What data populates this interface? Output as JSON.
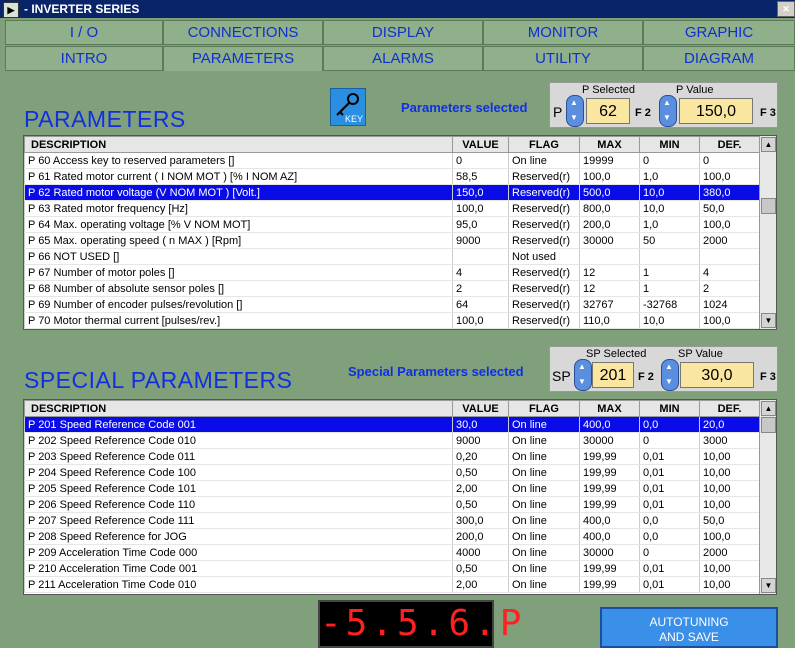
{
  "window": {
    "title": "- INVERTER SERIES"
  },
  "tabs_row1": [
    "I / O",
    "CONNECTIONS",
    "DISPLAY",
    "MONITOR",
    "GRAPHIC"
  ],
  "tabs_row2": [
    "INTRO",
    "PARAMETERS",
    "ALARMS",
    "UTILITY",
    "DIAGRAM"
  ],
  "parameters": {
    "title": "PARAMETERS",
    "selected_label": "Parameters selected",
    "key_label": "KEY",
    "selector": {
      "p_selected_label": "P Selected",
      "p_value_label": "P Value",
      "prefix": "P",
      "p_selected": "62",
      "p_value": "150,0",
      "f2": "F 2",
      "f3": "F 3"
    },
    "columns": [
      "DESCRIPTION",
      "VALUE",
      "FLAG",
      "MAX",
      "MIN",
      "DEF."
    ],
    "rows": [
      [
        "P 60   Access key to reserved parameters []",
        "0",
        "On line",
        "19999",
        "0",
        "0"
      ],
      [
        "P 61   Rated motor current ( I NOM MOT ) [% I NOM AZ]",
        "58,5",
        "Reserved(r)",
        "100,0",
        "1,0",
        "100,0"
      ],
      [
        "P 62   Rated motor voltage (V NOM MOT ) [Volt.]",
        "150,0",
        "Reserved(r)",
        "500,0",
        "10,0",
        "380,0"
      ],
      [
        "P 63   Rated motor frequency [Hz]",
        "100,0",
        "Reserved(r)",
        "800,0",
        "10,0",
        "50,0"
      ],
      [
        "P 64   Max. operating voltage [% V NOM MOT]",
        "95,0",
        "Reserved(r)",
        "200,0",
        "1,0",
        "100,0"
      ],
      [
        "P 65   Max. operating speed ( n MAX ) [Rpm]",
        "9000",
        "Reserved(r)",
        "30000",
        "50",
        "2000"
      ],
      [
        "P 66   NOT USED []",
        "",
        "Not used",
        "",
        "",
        ""
      ],
      [
        "P 67   Number of motor poles  []",
        "4",
        "Reserved(r)",
        "12",
        "1",
        "4"
      ],
      [
        "P 68   Number of absolute sensor poles []",
        "2",
        "Reserved(r)",
        "12",
        "1",
        "2"
      ],
      [
        "P 69   Number of encoder pulses/revolution []",
        "64",
        "Reserved(r)",
        "32767",
        "-32768",
        "1024"
      ],
      [
        "P 70   Motor thermal current [pulses/rev.]",
        "100,0",
        "Reserved(r)",
        "110,0",
        "10,0",
        "100,0"
      ]
    ],
    "selected_row": 2
  },
  "special": {
    "title": "SPECIAL PARAMETERS",
    "selected_label": "Special Parameters selected",
    "selector": {
      "sp_selected_label": "SP Selected",
      "sp_value_label": "SP Value",
      "prefix": "SP",
      "sp_selected": "201",
      "sp_value": "30,0",
      "f2": "F 2",
      "f3": "F 3"
    },
    "columns": [
      "DESCRIPTION",
      "VALUE",
      "FLAG",
      "MAX",
      "MIN",
      "DEF."
    ],
    "rows": [
      [
        "P 201   Speed Reference Code 001",
        "30,0",
        "On line",
        "400,0",
        "0,0",
        "20,0"
      ],
      [
        "P 202   Speed Reference Code 010",
        "9000",
        "On line",
        "30000",
        "0",
        "3000"
      ],
      [
        "P 203   Speed Reference Code 011",
        "0,20",
        "On line",
        "199,99",
        "0,01",
        "10,00"
      ],
      [
        "P 204   Speed Reference Code 100",
        "0,50",
        "On line",
        "199,99",
        "0,01",
        "10,00"
      ],
      [
        "P 205   Speed Reference Code 101",
        "2,00",
        "On line",
        "199,99",
        "0,01",
        "10,00"
      ],
      [
        "P 206   Speed Reference Code 110",
        "0,50",
        "On line",
        "199,99",
        "0,01",
        "10,00"
      ],
      [
        "P 207   Speed Reference Code 111",
        "300,0",
        "On line",
        "400,0",
        "0,0",
        "50,0"
      ],
      [
        "P 208   Speed Reference  for JOG",
        "200,0",
        "On line",
        "400,0",
        "0,0",
        "100,0"
      ],
      [
        "P 209   Acceleration Time Code 000",
        "4000",
        "On line",
        "30000",
        "0",
        "2000"
      ],
      [
        "P 210   Acceleration Time Code 001",
        "0,50",
        "On line",
        "199,99",
        "0,01",
        "10,00"
      ],
      [
        "P 211   Acceleration Time Code 010",
        "2,00",
        "On line",
        "199,99",
        "0,01",
        "10,00"
      ]
    ],
    "selected_row": 0
  },
  "led_display": "-5.5.6.P",
  "autotuning": {
    "line1": "AUTOTUNING",
    "line2": "AND SAVE"
  }
}
